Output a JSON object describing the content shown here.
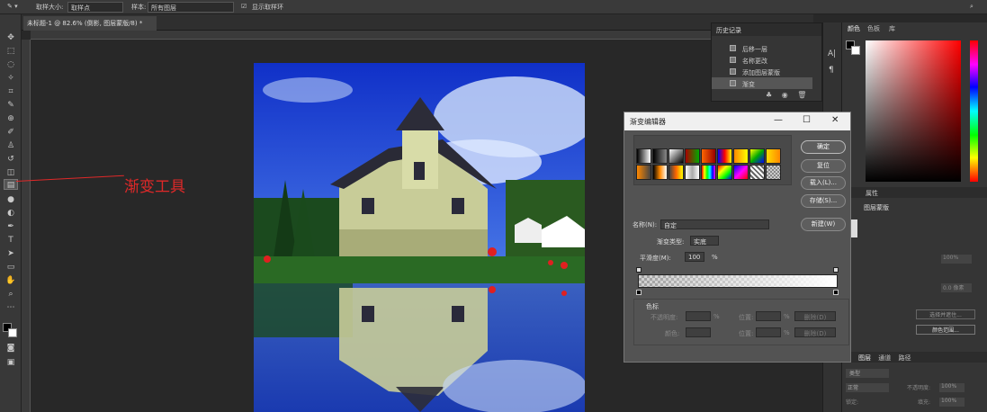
{
  "options_bar": {
    "sample_size_label": "取样大小:",
    "sample_size_value": "取样点",
    "sample_label": "样本:",
    "sample_value": "所有图层",
    "show_ring_label": "显示取样环"
  },
  "document_tab": {
    "title": "未标题-1 @ 82.6% (倒影, 图层蒙版/8) *",
    "close": "×"
  },
  "annotation": {
    "text": "渐变工具"
  },
  "history_panel": {
    "title": "历史记录",
    "items": [
      "后移一层",
      "名称更改",
      "添加图层蒙版",
      "渐变"
    ],
    "selected_index": 3
  },
  "right_panel": {
    "tabs": [
      "颜色",
      "色板",
      "库"
    ],
    "layers_tabs": [
      "图层",
      "通道",
      "路径"
    ],
    "props_tab": "属性",
    "layer_mask_label": "图层蒙版",
    "select_mask_button": "选择并遮住...",
    "color_range_button": "颜色范围...",
    "invert_button": "反相",
    "kind_label": "类型",
    "blend_mode": "正常",
    "opacity_label": "不透明度:",
    "opacity_value": "100%",
    "lock_label": "锁定:",
    "fill_label": "填充:",
    "fill_value": "100%",
    "density_value": "100%",
    "feather_value": "0.0 像素"
  },
  "gradient_editor": {
    "title": "渐变编辑器",
    "presets_label": "预设",
    "buttons": {
      "ok": "确定",
      "reset": "复位",
      "load": "载入(L)...",
      "save": "存储(S)...",
      "new": "新建(W)"
    },
    "name_label": "名称(N):",
    "name_value": "自定",
    "type_label": "渐变类型:",
    "type_value": "实底",
    "smoothness_label": "平滑度(M):",
    "smoothness_value": "100",
    "smoothness_unit": "%",
    "stops_label": "色标",
    "opacity_label": "不透明度:",
    "percent": "%",
    "location_label": "位置:",
    "delete_label": "删除(D)",
    "color_label": "颜色:"
  },
  "colors": {
    "accent": "#e02828",
    "panel": "#353535",
    "dialog": "#535353"
  }
}
